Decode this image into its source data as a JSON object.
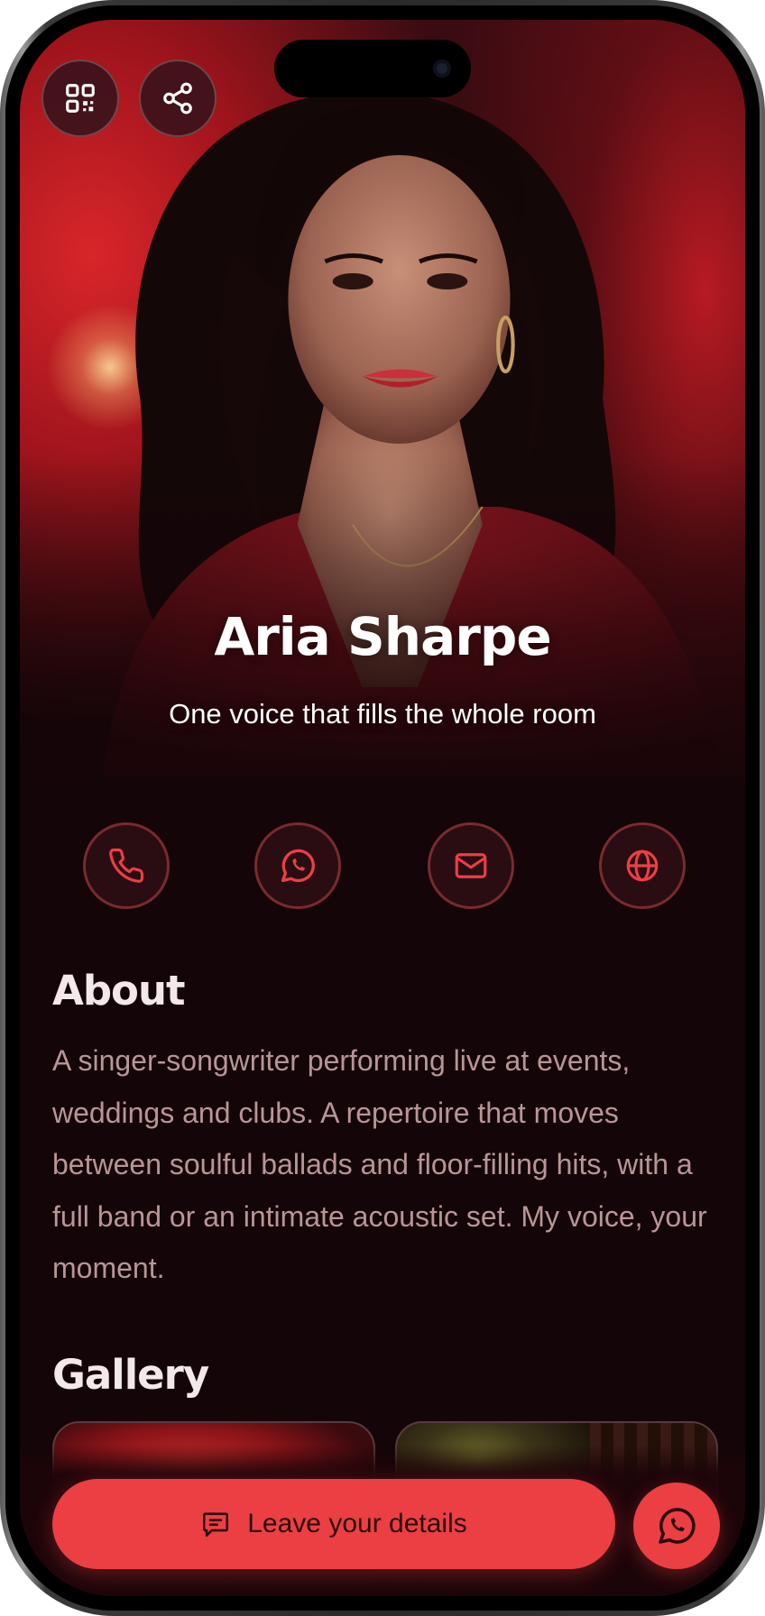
{
  "profile": {
    "name": "Aria Sharpe",
    "tagline": "One voice that fills the whole room"
  },
  "hero_actions": [
    {
      "name": "qr-code",
      "icon": "qr-code-icon"
    },
    {
      "name": "share",
      "icon": "share-icon"
    }
  ],
  "contact": [
    {
      "name": "phone",
      "icon": "phone-icon"
    },
    {
      "name": "whatsapp",
      "icon": "whatsapp-icon"
    },
    {
      "name": "email",
      "icon": "mail-icon"
    },
    {
      "name": "website",
      "icon": "globe-icon"
    }
  ],
  "about": {
    "title": "About",
    "text": "A singer-songwriter performing live at events, weddings and clubs. A repertoire that moves between soulful ballads and floor-filling hits, with a full band or an intimate acoustic set. My voice, your moment."
  },
  "gallery": {
    "title": "Gallery"
  },
  "cta": {
    "label": "Leave your details",
    "icon": "message-icon"
  },
  "fab": {
    "icon": "whatsapp-icon"
  },
  "colors": {
    "accent": "#ec3f43",
    "background": "#140508",
    "text_primary": "#f4e9ea",
    "text_muted": "#b99597"
  }
}
